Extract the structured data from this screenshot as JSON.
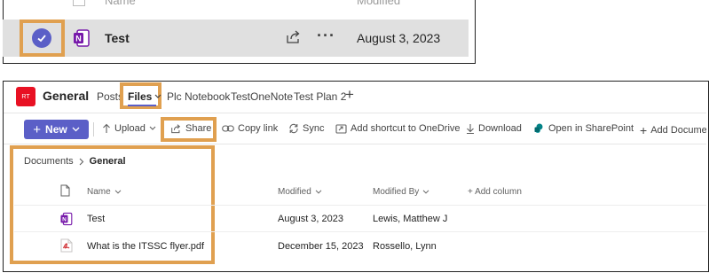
{
  "top": {
    "header_name": "Name",
    "header_modified": "Modified",
    "row_name": "Test",
    "row_date": "August 3, 2023",
    "more_dots": "···"
  },
  "header": {
    "team_initials": "RT",
    "channel": "General",
    "tabs": [
      "Posts",
      "Files",
      "Plc Notebook",
      "TestOneNote",
      "Test Plan 2"
    ],
    "add_tab": "+"
  },
  "toolbar": {
    "new_label": "New",
    "upload": "Upload",
    "share": "Share",
    "copy_link": "Copy link",
    "sync": "Sync",
    "add_shortcut": "Add shortcut to OneDrive",
    "download": "Download",
    "open_sharepoint": "Open in SharePoint",
    "add_document": "Add Document"
  },
  "breadcrumb": {
    "root": "Documents",
    "current": "General"
  },
  "table": {
    "columns": {
      "name": "Name",
      "modified": "Modified",
      "modified_by": "Modified By",
      "add_column": "+ Add column"
    },
    "rows": [
      {
        "name": "Test",
        "modified": "August 3, 2023",
        "modified_by": "Lewis, Matthew J",
        "icon": "onenote-icon"
      },
      {
        "name": "What is the ITSSC flyer.pdf",
        "modified": "December 15, 2023",
        "modified_by": "Rossello, Lynn",
        "icon": "pdf-icon"
      }
    ]
  },
  "colors": {
    "accent": "#5b5fc7",
    "highlight": "#e0a050",
    "team_badge": "#e81123",
    "onenote": "#7719aa"
  }
}
